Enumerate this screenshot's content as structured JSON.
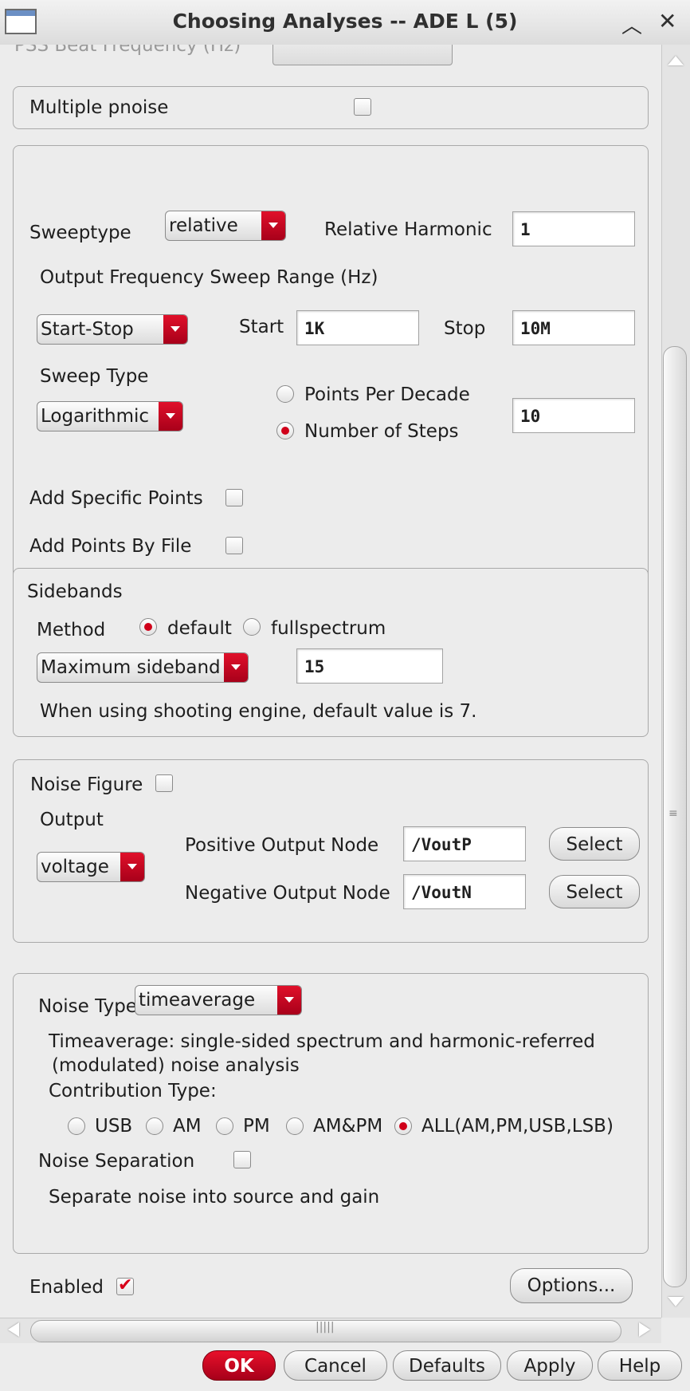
{
  "window": {
    "title": "Choosing Analyses -- ADE L (5)"
  },
  "top": {
    "cut_label": "PSS Beat Frequency (Hz)"
  },
  "multiple_pnoise": {
    "label": "Multiple pnoise",
    "checked": false
  },
  "sweep": {
    "sweeptype_label": "Sweeptype",
    "sweeptype_value": "relative",
    "relative_harmonic_label": "Relative Harmonic",
    "relative_harmonic_value": "1",
    "range_label": "Output Frequency Sweep Range (Hz)",
    "range_mode": "Start-Stop",
    "start_label": "Start",
    "start_value": "1K",
    "stop_label": "Stop",
    "stop_value": "10M",
    "sweep_type_label": "Sweep Type",
    "sweep_type_value": "Logarithmic",
    "points_per_decade_label": "Points Per Decade",
    "number_of_steps_label": "Number of Steps",
    "selected_option": "Number of Steps",
    "steps_value": "10",
    "add_specific_points_label": "Add Specific Points",
    "add_points_by_file_label": "Add Points By File"
  },
  "sidebands": {
    "title": "Sidebands",
    "method_label": "Method",
    "default_label": "default",
    "fullspectrum_label": "fullspectrum",
    "selected": "default",
    "mode": "Maximum sideband",
    "value": "15",
    "note": "When using shooting engine, default value is 7."
  },
  "noise_figure": {
    "label": "Noise Figure",
    "output_label": "Output",
    "output_type": "voltage",
    "pos_label": "Positive Output Node",
    "pos_value": "/VoutP",
    "neg_label": "Negative Output Node",
    "neg_value": "/VoutN",
    "select_label": "Select"
  },
  "noise_type": {
    "label": "Noise Type",
    "value": "timeaverage",
    "desc_line1": "Timeaverage: single-sided spectrum and harmonic-referred",
    "desc_line2": "(modulated) noise analysis",
    "contribution_label": "Contribution Type:",
    "contributions": [
      "USB",
      "AM",
      "PM",
      "AM&PM",
      "ALL(AM,PM,USB,LSB)"
    ],
    "selected_contribution": "ALL(AM,PM,USB,LSB)",
    "separation_label": "Noise Separation",
    "separation_note": "Separate noise into source and gain"
  },
  "footer": {
    "enabled_label": "Enabled",
    "enabled_checked": true,
    "options_label": "Options..."
  },
  "buttons": {
    "ok": "OK",
    "cancel": "Cancel",
    "defaults": "Defaults",
    "apply": "Apply",
    "help": "Help"
  },
  "colors": {
    "accent": "#d0001a",
    "background": "#ececec"
  }
}
